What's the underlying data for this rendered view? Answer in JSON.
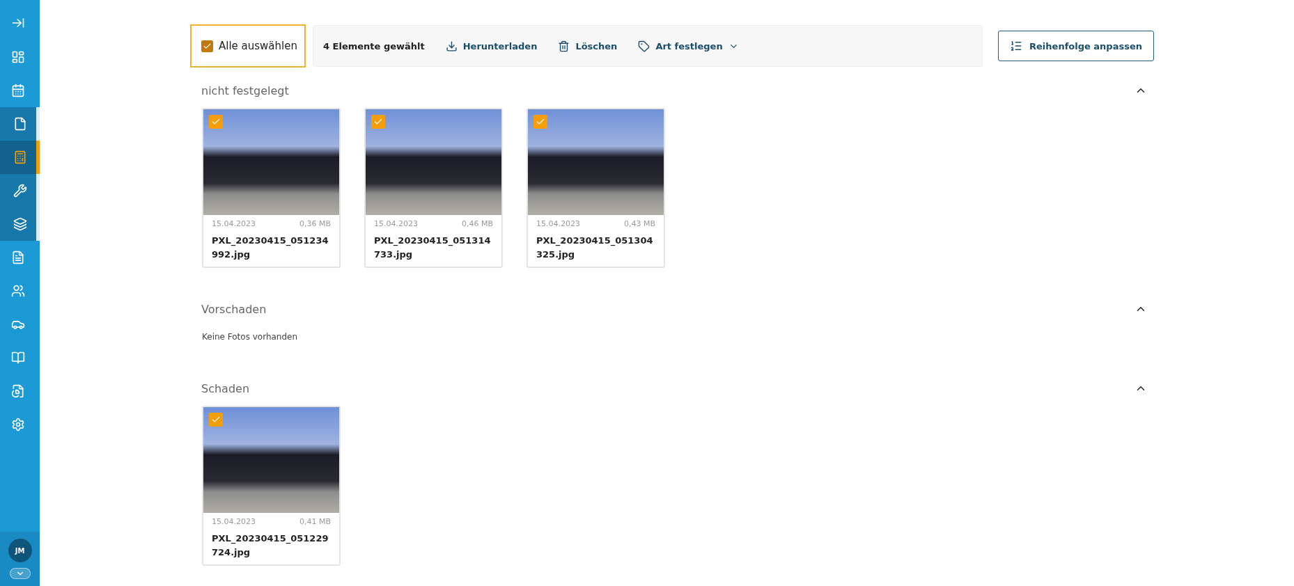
{
  "sidebar": {
    "items": [
      {
        "selected": false,
        "grouped": false
      },
      {
        "selected": false,
        "grouped": false
      },
      {
        "selected": false,
        "grouped": true
      },
      {
        "selected": true,
        "grouped": true
      },
      {
        "selected": false,
        "grouped": true
      },
      {
        "selected": false,
        "grouped": true
      },
      {
        "selected": false,
        "grouped": false
      },
      {
        "selected": false,
        "grouped": false
      },
      {
        "selected": false,
        "grouped": false
      },
      {
        "selected": false,
        "grouped": false
      },
      {
        "selected": false,
        "grouped": false
      },
      {
        "selected": false,
        "grouped": false
      }
    ],
    "avatar": "JM"
  },
  "toolbar": {
    "select_all": {
      "label": "Alle auswählen",
      "checked": true
    },
    "count": "4 Elemente gewählt",
    "actions": [
      {
        "label": "Herunterladen",
        "kind": "download"
      },
      {
        "label": "Löschen",
        "kind": "delete"
      },
      {
        "label": "Art festlegen",
        "kind": "dropdown"
      }
    ],
    "order_button": "Reihenfolge anpassen"
  },
  "sections": [
    {
      "title": "nicht festgelegt",
      "expanded": true,
      "photos": [
        {
          "date": "15.04.2023",
          "size": "0,36 MB",
          "name": "PXL_20230415_051234992.jpg",
          "checked": true
        },
        {
          "date": "15.04.2023",
          "size": "0,46 MB",
          "name": "PXL_20230415_051314733.jpg",
          "checked": true
        },
        {
          "date": "15.04.2023",
          "size": "0,43 MB",
          "name": "PXL_20230415_051304325.jpg",
          "checked": true
        }
      ]
    },
    {
      "title": "Vorschaden",
      "expanded": true,
      "empty_text": "Keine Fotos vorhanden"
    },
    {
      "title": "Schaden",
      "expanded": true,
      "photos": [
        {
          "date": "15.04.2023",
          "size": "0,41 MB",
          "name": "PXL_20230415_051229724.jpg",
          "checked": true
        }
      ]
    }
  ]
}
